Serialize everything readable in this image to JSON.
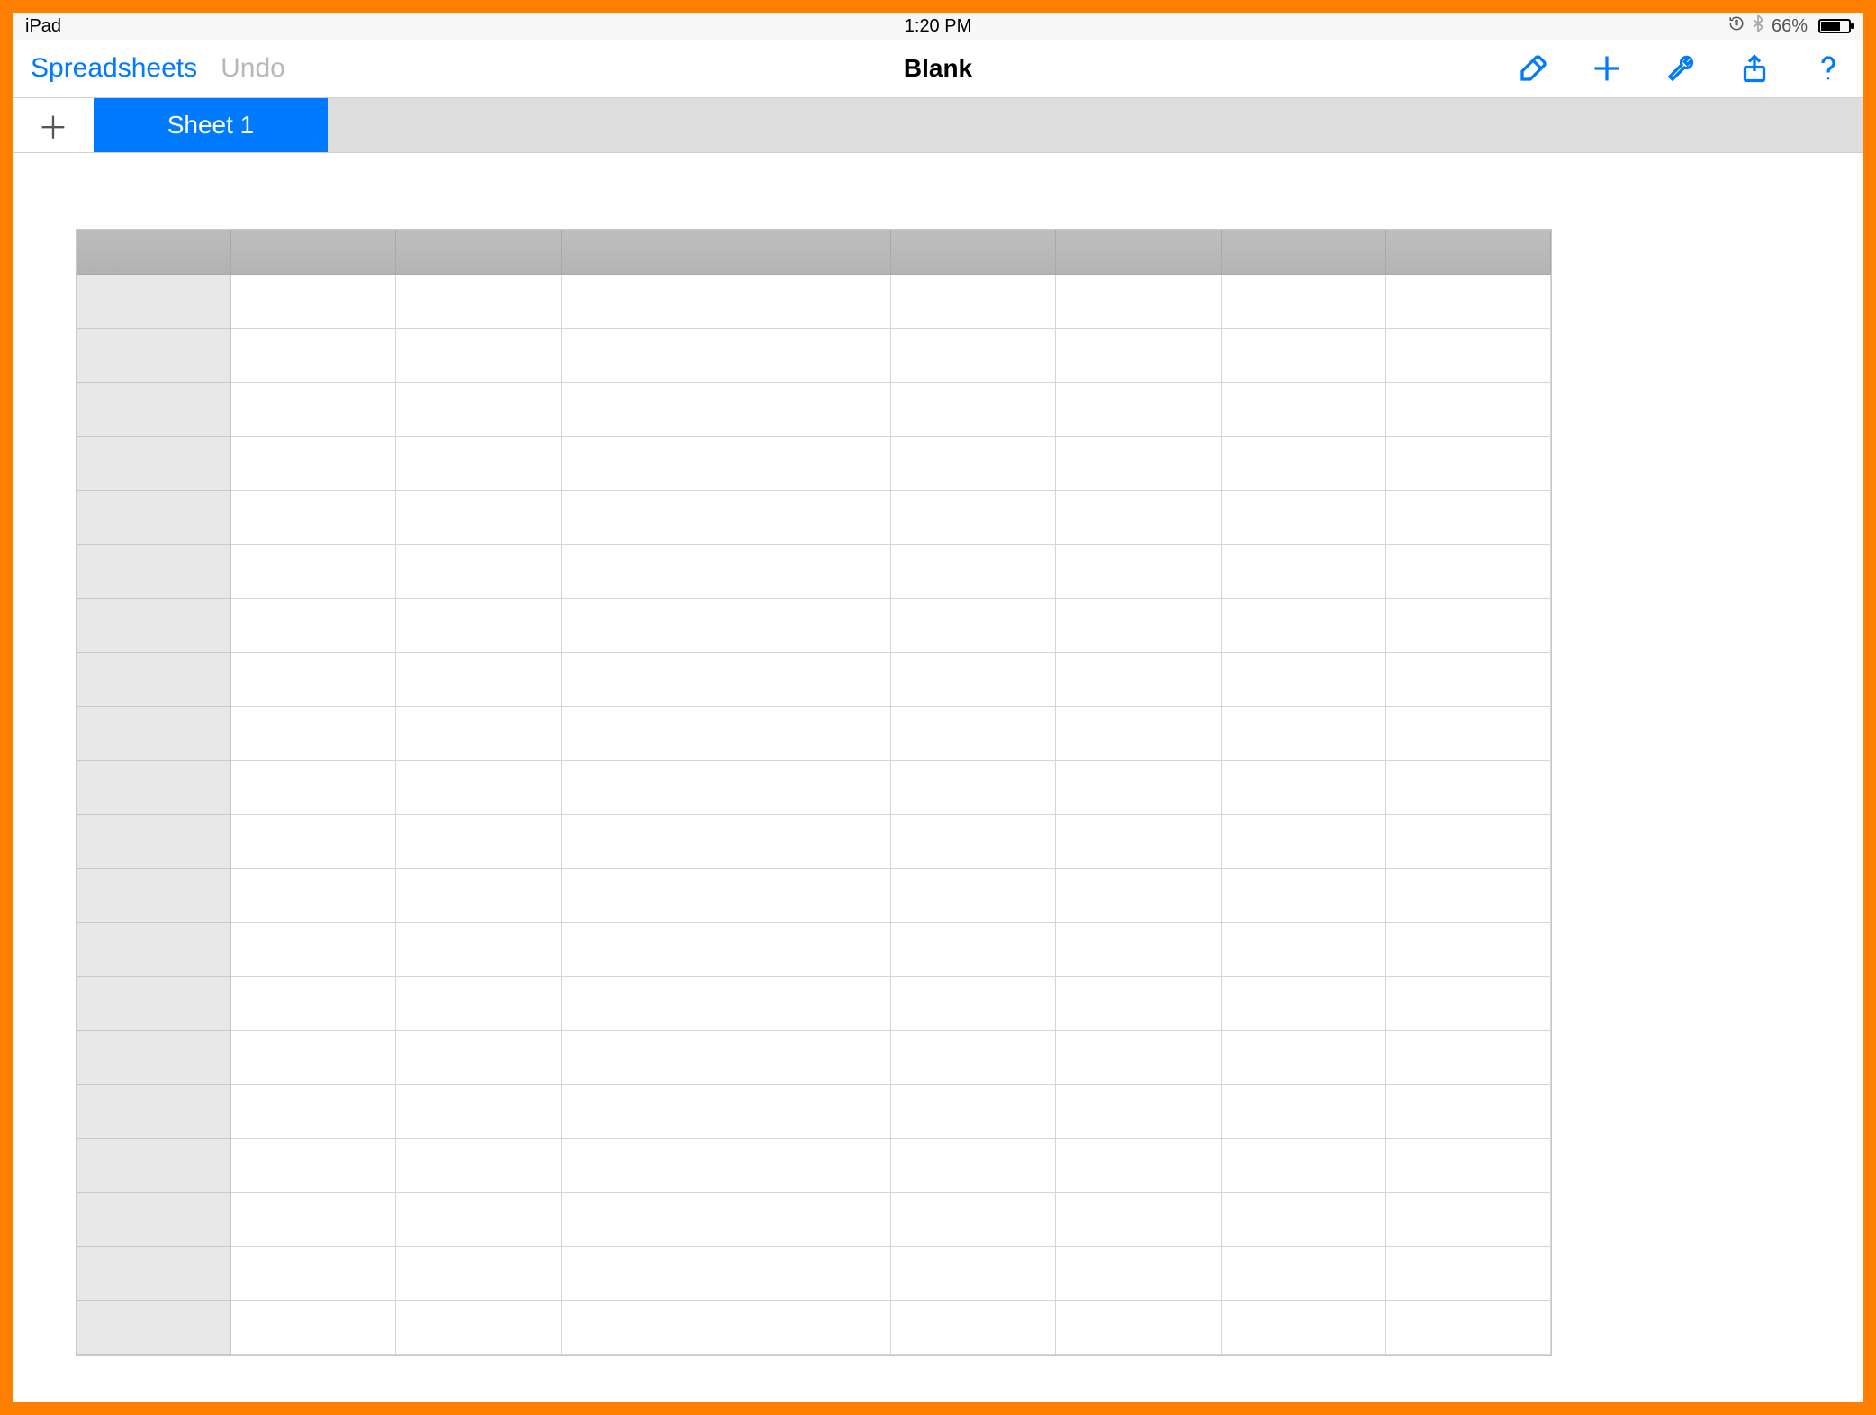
{
  "status_bar": {
    "device_label": "iPad",
    "time": "1:20 PM",
    "battery_percent": "66%"
  },
  "toolbar": {
    "back_label": "Spreadsheets",
    "undo_label": "Undo",
    "document_title": "Blank"
  },
  "sheet_tabs": {
    "add_symbol": "＋",
    "active_tab_label": "Sheet 1"
  },
  "grid": {
    "columns": 8,
    "rows": 20
  },
  "icons": {
    "format": "format-brush-icon",
    "add": "plus-icon",
    "tools": "wrench-icon",
    "share": "share-icon",
    "help": "help-icon",
    "orientation_lock": "orientation-lock-icon",
    "bluetooth": "bluetooth-icon",
    "battery": "battery-icon"
  }
}
